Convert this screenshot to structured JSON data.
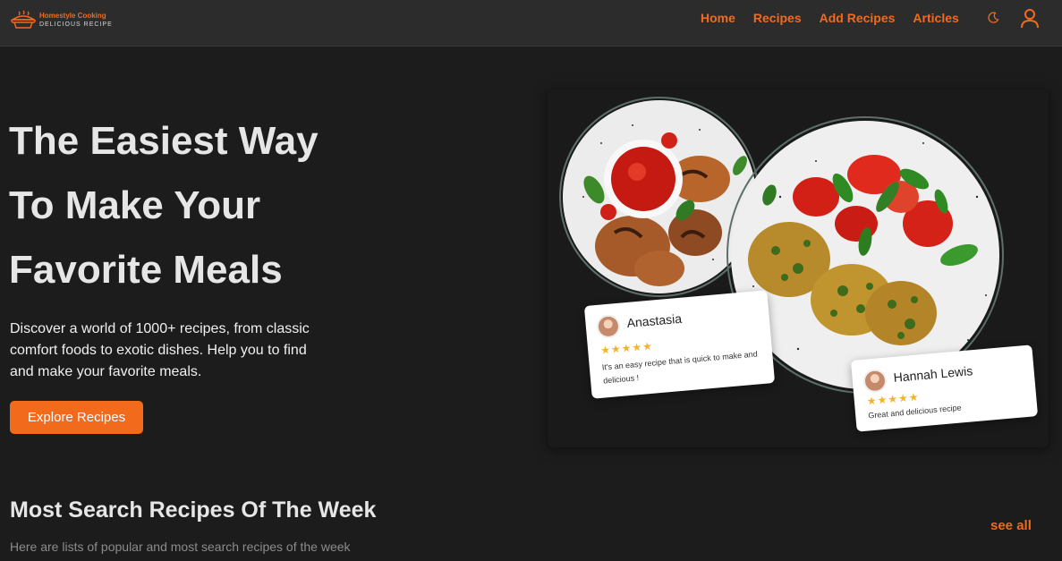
{
  "brand": {
    "name": "Homestyle Cooking",
    "tagline": "DELICIOUS RECIPE"
  },
  "nav": {
    "links": [
      "Home",
      "Recipes",
      "Add Recipes",
      "Articles"
    ],
    "theme_icon": "moon-icon",
    "user_icon": "user-icon"
  },
  "hero": {
    "title_lines": [
      "The Easiest Way",
      "To Make Your",
      "Favorite Meals"
    ],
    "description": "Discover a world of 1000+ recipes, from classic comfort foods to exotic dishes. Help you to find and make your favorite meals.",
    "cta_label": "Explore Recipes"
  },
  "reviews": [
    {
      "name": "Anastasia",
      "stars": "★★★★★",
      "text": "It's an easy recipe that is quick to make and delicious !"
    },
    {
      "name": "Hannah Lewis",
      "stars": "★★★★★",
      "text": "Great and delicious recipe"
    }
  ],
  "section": {
    "title": "Most Search Recipes Of The Week",
    "subtitle": "Here are lists of popular and most search recipes of the week",
    "see_all_label": "see all"
  },
  "colors": {
    "accent": "#f26a1c",
    "background": "#1c1c1d",
    "navbar": "#2c2c2c",
    "star": "#f2b32a"
  }
}
